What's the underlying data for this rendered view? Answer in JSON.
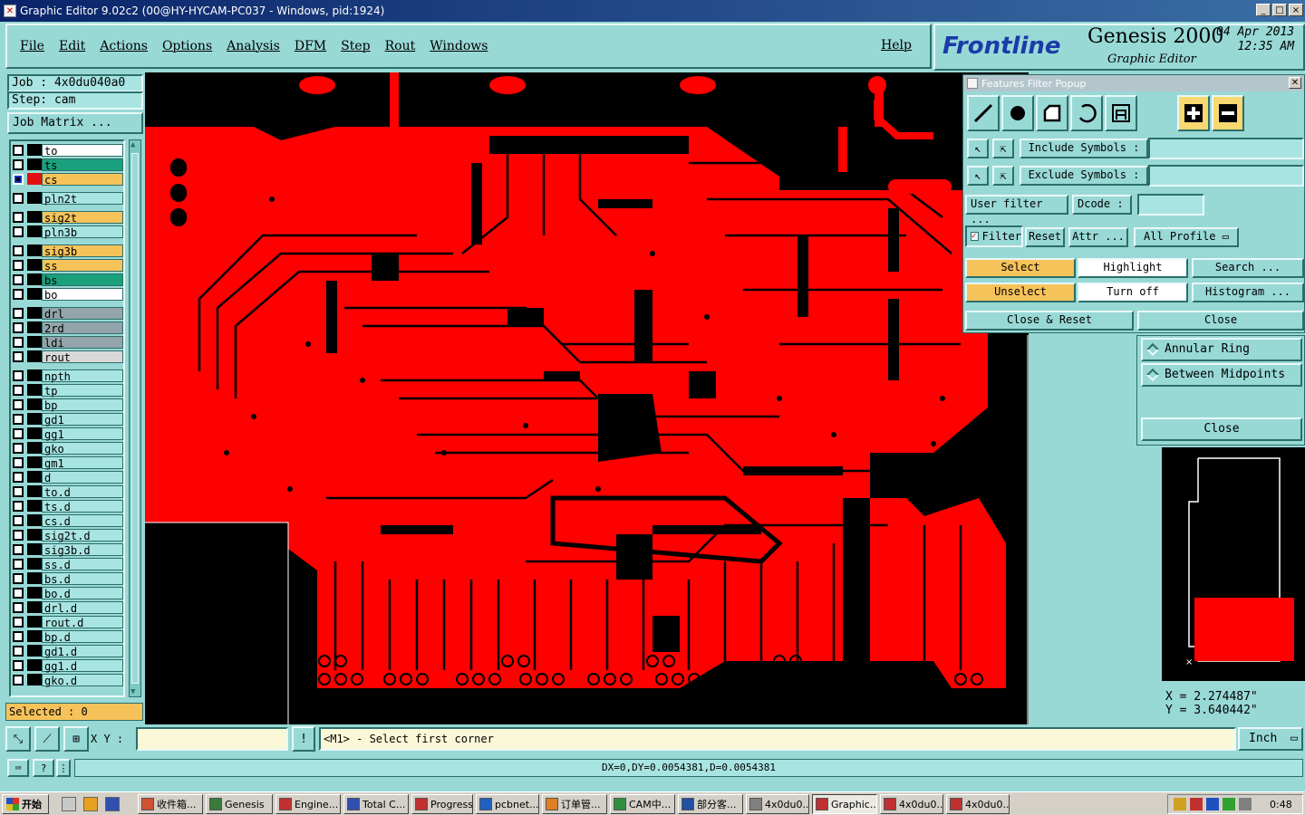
{
  "window": {
    "title": "Graphic Editor 9.02c2 (00@HY-HYCAM-PC037 - Windows, pid:1924)",
    "controls": [
      "_",
      "□",
      "×"
    ]
  },
  "menu": {
    "items": [
      "File",
      "Edit",
      "Actions",
      "Options",
      "Analysis",
      "DFM",
      "Step",
      "Rout",
      "Windows"
    ],
    "help": "Help"
  },
  "logo": {
    "brand": "Frontline",
    "product": "Genesis 2000",
    "subtitle": "Graphic Editor",
    "date": "04 Apr 2013",
    "time": "12:35 AM"
  },
  "job": {
    "job_label": "Job : 4x0du040a0",
    "step_label": "Step: cam",
    "matrix_button": "Job Matrix ..."
  },
  "layers": [
    {
      "name": "to",
      "color": "#ffffff",
      "marker": ""
    },
    {
      "name": "ts",
      "color": "#1aa07c",
      "marker": ""
    },
    {
      "name": "cs",
      "color": "#f6c35a",
      "marker": "active",
      "swatch": "#e01010"
    },
    {
      "name": "pln2t",
      "color": "#a8e4e2",
      "marker": ""
    },
    {
      "name": "sig2t",
      "color": "#f6c35a",
      "marker": ""
    },
    {
      "name": "pln3b",
      "color": "#a8e4e2",
      "marker": ""
    },
    {
      "name": "sig3b",
      "color": "#f6c35a",
      "marker": ""
    },
    {
      "name": "ss",
      "color": "#f6c35a",
      "marker": ""
    },
    {
      "name": "bs",
      "color": "#1aa07c",
      "marker": ""
    },
    {
      "name": "bo",
      "color": "#ffffff",
      "marker": ""
    },
    {
      "name": "drl",
      "color": "#93a4aa",
      "marker": ""
    },
    {
      "name": "2rd",
      "color": "#93a4aa",
      "marker": ""
    },
    {
      "name": "ldi",
      "color": "#93a4aa",
      "marker": ""
    },
    {
      "name": "rout",
      "color": "#d8d8d8",
      "marker": ""
    },
    {
      "name": "npth",
      "color": "#a8e4e2",
      "marker": ""
    },
    {
      "name": "tp",
      "color": "#a8e4e2",
      "marker": ""
    },
    {
      "name": "bp",
      "color": "#a8e4e2",
      "marker": ""
    },
    {
      "name": "gd1",
      "color": "#a8e4e2",
      "marker": ""
    },
    {
      "name": "gg1",
      "color": "#a8e4e2",
      "marker": ""
    },
    {
      "name": "gko",
      "color": "#a8e4e2",
      "marker": ""
    },
    {
      "name": "gm1",
      "color": "#a8e4e2",
      "marker": ""
    },
    {
      "name": "d",
      "color": "#a8e4e2",
      "marker": ""
    },
    {
      "name": "to.d",
      "color": "#a8e4e2",
      "marker": ""
    },
    {
      "name": "ts.d",
      "color": "#a8e4e2",
      "marker": ""
    },
    {
      "name": "cs.d",
      "color": "#a8e4e2",
      "marker": ""
    },
    {
      "name": "sig2t.d",
      "color": "#a8e4e2",
      "marker": ""
    },
    {
      "name": "sig3b.d",
      "color": "#a8e4e2",
      "marker": ""
    },
    {
      "name": "ss.d",
      "color": "#a8e4e2",
      "marker": ""
    },
    {
      "name": "bs.d",
      "color": "#a8e4e2",
      "marker": ""
    },
    {
      "name": "bo.d",
      "color": "#a8e4e2",
      "marker": ""
    },
    {
      "name": "drl.d",
      "color": "#a8e4e2",
      "marker": ""
    },
    {
      "name": "rout.d",
      "color": "#a8e4e2",
      "marker": ""
    },
    {
      "name": "bp.d",
      "color": "#a8e4e2",
      "marker": ""
    },
    {
      "name": "gd1.d",
      "color": "#a8e4e2",
      "marker": ""
    },
    {
      "name": "gg1.d",
      "color": "#a8e4e2",
      "marker": ""
    },
    {
      "name": "gko.d",
      "color": "#a8e4e2",
      "marker": ""
    }
  ],
  "selected_label": "Selected : 0",
  "filter_popup": {
    "title": "Features Filter Popup",
    "include_label": "Include Symbols :",
    "exclude_label": "Exclude Symbols :",
    "include_value": "",
    "exclude_value": "",
    "user_filter": "User filter ...",
    "dcode_label": "Dcode :",
    "dcode_value": "",
    "filter_label": "Filter",
    "reset": "Reset",
    "attr": "Attr ...",
    "profile": "All Profile",
    "select": "Select",
    "highlight": "Highlight",
    "search": "Search ...",
    "unselect": "Unselect",
    "turn_off": "Turn off",
    "histogram": "Histogram ...",
    "close_reset": "Close & Reset",
    "close": "Close"
  },
  "side": {
    "annular_ring": "Annular Ring",
    "between_midpoints": "Between Midpoints",
    "close": "Close"
  },
  "coords": {
    "x": "X = 2.274487\"",
    "y": "Y = 3.640442\""
  },
  "cmd": {
    "xy_label": "X Y :",
    "xy_value": "",
    "prompt": "<M1> - Select first corner",
    "unit": "Inch"
  },
  "status": {
    "message": "DX=0,DY=0.0054381,D=0.0054381"
  },
  "taskbar": {
    "start": "开始",
    "tasks": [
      {
        "label": "收件箱...",
        "icon_color": "#d05030"
      },
      {
        "label": "Genesis",
        "icon_color": "#3a7a3a"
      },
      {
        "label": "Engine...",
        "icon_color": "#c03030"
      },
      {
        "label": "Total C...",
        "icon_color": "#3050b0"
      },
      {
        "label": "Progress",
        "icon_color": "#c03030"
      },
      {
        "label": "pcbnet...",
        "icon_color": "#2060c0"
      },
      {
        "label": "订单管...",
        "icon_color": "#e08020"
      },
      {
        "label": "CAM中...",
        "icon_color": "#309040"
      },
      {
        "label": "部分客...",
        "icon_color": "#2050a0"
      },
      {
        "label": "4x0du0...",
        "icon_color": "#808080"
      },
      {
        "label": "Graphic...",
        "icon_color": "#c03030",
        "active": true
      },
      {
        "label": "4x0du0...",
        "icon_color": "#c03030"
      },
      {
        "label": "4x0du0...",
        "icon_color": "#c03030"
      }
    ],
    "clock": "0:48"
  },
  "colors": {
    "copper": "#ff0000",
    "canvas_bg": "#000000",
    "panel": "#98d9d6",
    "accent_orange": "#f6c35a"
  }
}
